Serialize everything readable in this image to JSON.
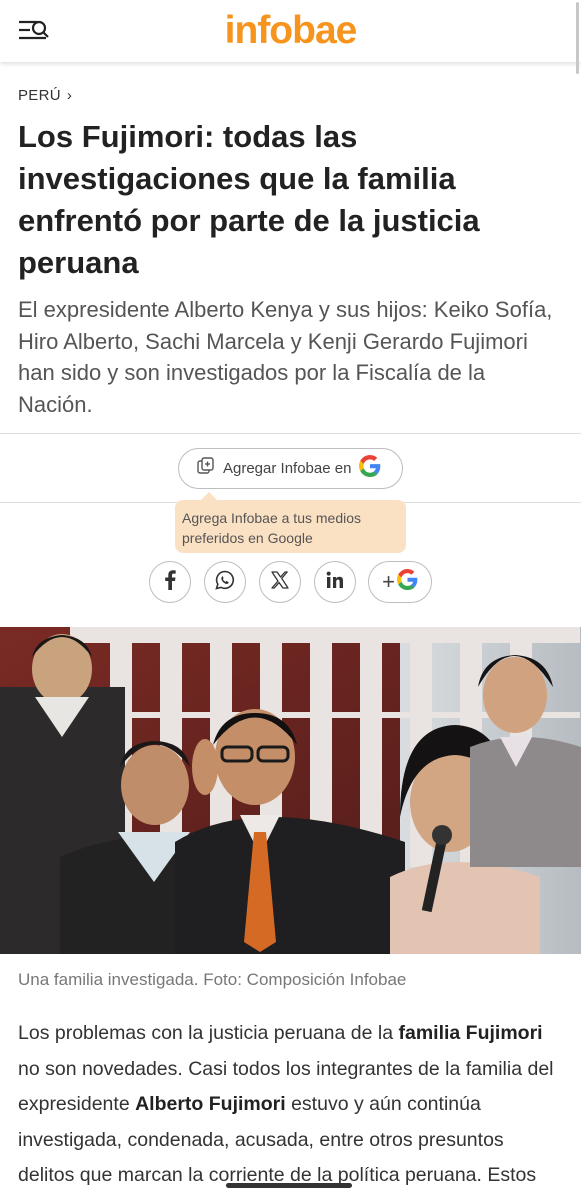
{
  "header": {
    "logo": "infobae",
    "menu_icon": "menu-search-icon",
    "logo_color": "#f7941d"
  },
  "article": {
    "section": "PERÚ",
    "headline": "Los Fujimori: todas las investigaciones que la familia enfrentó por parte de la justicia peruana",
    "subhead": "El expresidente Alberto Kenya y sus hijos: Keiko Sofía, Hiro Alberto, Sachi Marcela y Kenji Gerardo Fujimori han sido y son investigados por la Fiscalía de la Nación.",
    "google_button": "Agregar Infobae en",
    "tooltip": "Agrega Infobae a tus medios preferidos en Google",
    "share": [
      "facebook-icon",
      "whatsapp-icon",
      "x-icon",
      "linkedin-icon",
      "google-add-icon"
    ],
    "share_add_label": "+",
    "caption": "Una familia investigada. Foto: Composición Infobae",
    "body": {
      "p1_a": "Los problemas con la justicia peruana de la ",
      "p1_b": "familia Fujimori",
      "p1_c": " no son novedades. Casi todos los integrantes de la familia del expresidente ",
      "p1_d": "Alberto Fujimori",
      "p1_e": " estuvo y aún continúa investigada, condenada, acusada, entre otros presuntos delitos que marcan la corriente de la política peruana. Estos"
    }
  }
}
